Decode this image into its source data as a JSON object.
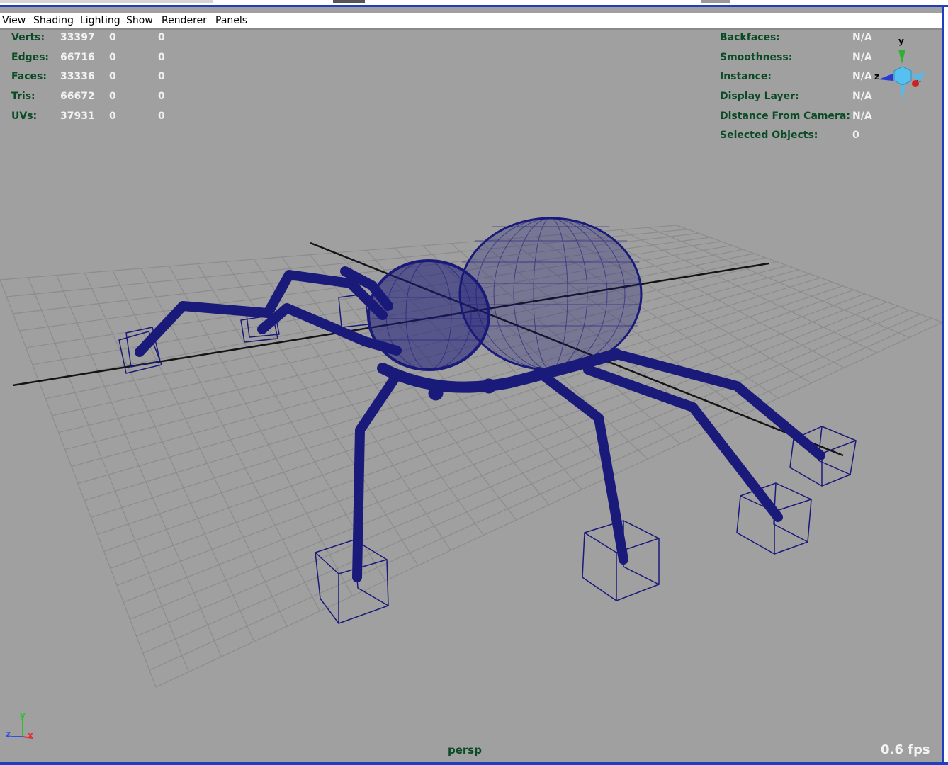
{
  "menu": [
    "View",
    "Shading",
    "Lighting",
    "Show",
    "Renderer",
    "Panels"
  ],
  "stats_left": [
    {
      "label": "Verts:",
      "v1": "33397",
      "v2": "0",
      "v3": "0"
    },
    {
      "label": "Edges:",
      "v1": "66716",
      "v2": "0",
      "v3": "0"
    },
    {
      "label": "Faces:",
      "v1": "33336",
      "v2": "0",
      "v3": "0"
    },
    {
      "label": "Tris:",
      "v1": "66672",
      "v2": "0",
      "v3": "0"
    },
    {
      "label": "UVs:",
      "v1": "37931",
      "v2": "0",
      "v3": "0"
    }
  ],
  "stats_right": [
    {
      "label": "Backfaces:",
      "value": "N/A"
    },
    {
      "label": "Smoothness:",
      "value": "N/A"
    },
    {
      "label": "Instance:",
      "value": "N/A"
    },
    {
      "label": "Display Layer:",
      "value": "N/A"
    },
    {
      "label": "Distance From Camera:",
      "value": "N/A"
    },
    {
      "label": "Selected Objects:",
      "value": "0"
    }
  ],
  "view_cube": {
    "x": "x",
    "y": "y",
    "z": "z"
  },
  "axis_triad": {
    "x": "x",
    "y": "y",
    "z": "z"
  },
  "camera_name": "persp",
  "fps": "0.6 fps",
  "colors": {
    "viewport_bg": "#a0a0a0",
    "hud_text": "#0a4a25",
    "wireframe": "#1a1a7a",
    "grid": "#8c8c8c",
    "axis_x": "#e03030",
    "axis_y": "#30c030",
    "axis_z": "#3050e0"
  }
}
